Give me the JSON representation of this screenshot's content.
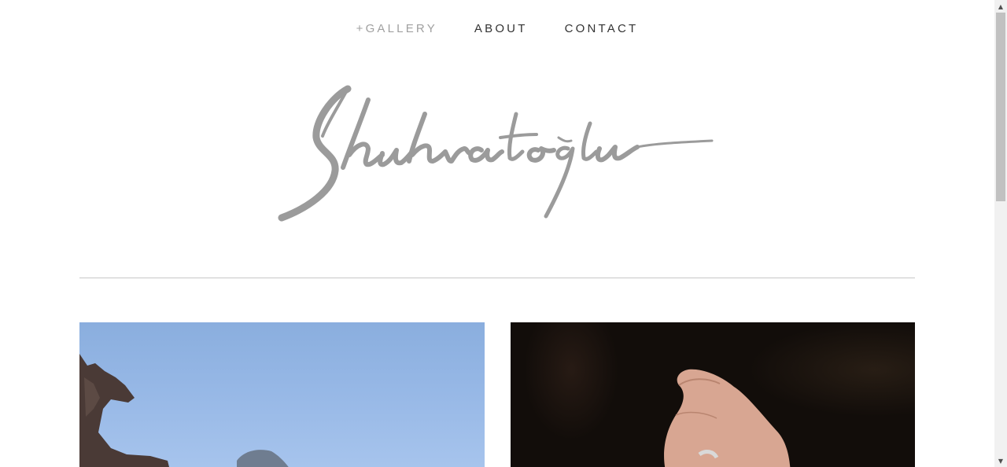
{
  "nav": {
    "items": [
      {
        "label": "+GALLERY",
        "active": true
      },
      {
        "label": "ABOUT",
        "active": false
      },
      {
        "label": "CONTACT",
        "active": false
      }
    ]
  },
  "logo": {
    "text": "Shuhratoglu",
    "color": "#9b9b9b"
  },
  "colors": {
    "nav_text": "#333333",
    "nav_active": "#a0a0a0",
    "divider": "#c8c8c8"
  },
  "gallery": {
    "items": [
      {
        "subject": "sky with rock sculpture"
      },
      {
        "subject": "hand wearing ring on dark background"
      }
    ]
  },
  "scrollbar": {
    "up_icon": "triangle-up",
    "down_icon": "triangle-down"
  }
}
